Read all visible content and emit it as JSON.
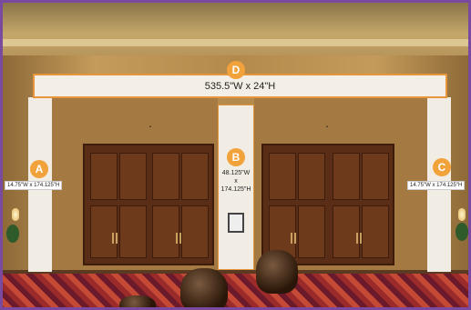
{
  "scene": {
    "header_dimension": "535.5\"W x 24\"H",
    "badges": {
      "a": "A",
      "b": "B",
      "c": "C",
      "d": "D"
    },
    "label_a": "14.75\"W x 174.125\"H",
    "label_c": "14.75\"W x 174.125\"H",
    "label_b": [
      "48.125\"W",
      "x",
      "174.125\"H"
    ],
    "accent_color": "#f2a23a",
    "border_color": "#7a4aa0"
  }
}
